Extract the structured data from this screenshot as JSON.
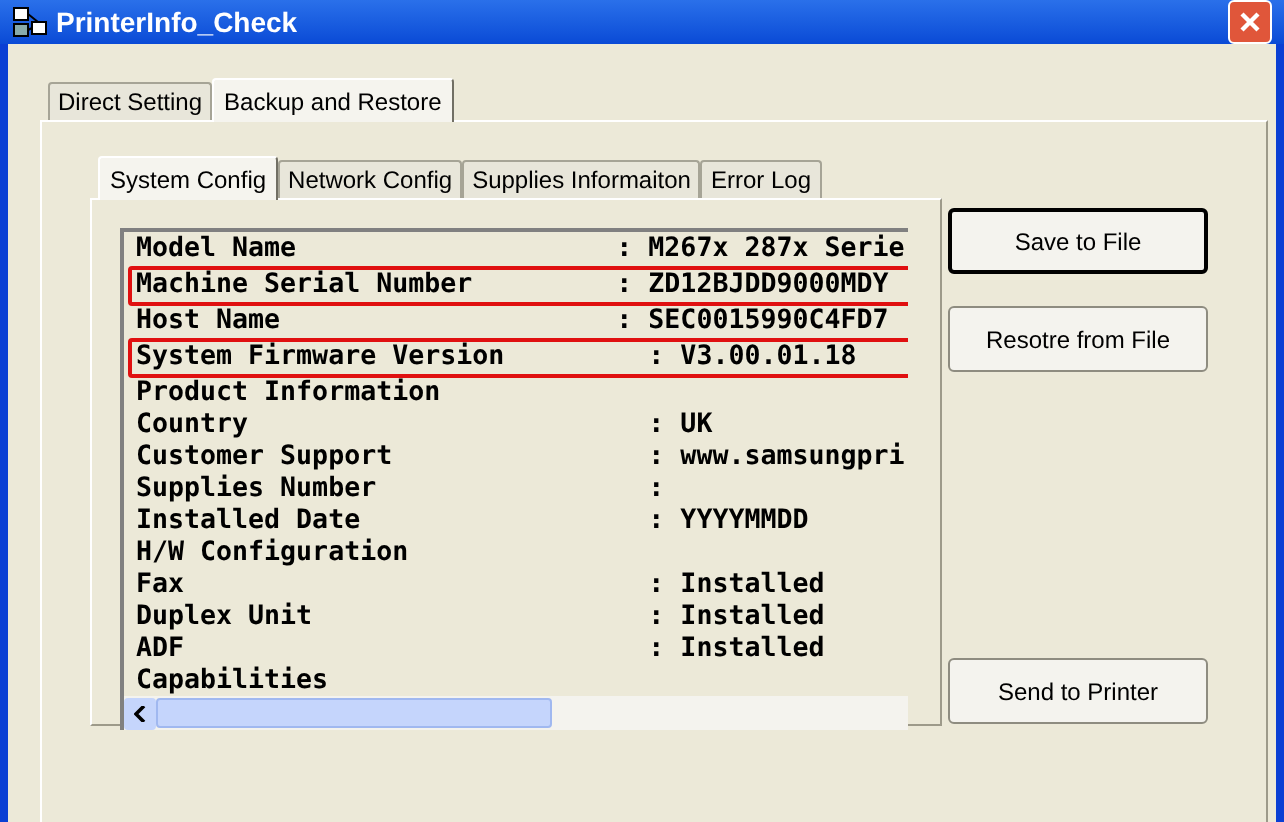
{
  "window": {
    "title": "PrinterInfo_Check"
  },
  "outer_tabs": [
    {
      "label": "Direct Setting",
      "selected": false
    },
    {
      "label": "Backup and Restore",
      "selected": true
    }
  ],
  "inner_tabs": [
    {
      "label": "System Config",
      "selected": true
    },
    {
      "label": "Network Config",
      "selected": false
    },
    {
      "label": "Supplies Informaiton",
      "selected": false
    },
    {
      "label": "Error Log",
      "selected": false
    }
  ],
  "lines": [
    {
      "text": "Model Name                    : M267x 287x Serie",
      "highlighted": false
    },
    {
      "text": "Machine Serial Number         : ZD12BJDD9000MDY",
      "highlighted": true
    },
    {
      "text": "Host Name                     : SEC0015990C4FD7",
      "highlighted": false
    },
    {
      "text": "System Firmware Version         : V3.00.01.18",
      "highlighted": true
    },
    {
      "text": "Product Information",
      "highlighted": false
    },
    {
      "text": "Country                         : UK",
      "highlighted": false
    },
    {
      "text": "Customer Support                : www.samsungpri",
      "highlighted": false
    },
    {
      "text": "Supplies Number                 :",
      "highlighted": false
    },
    {
      "text": "Installed Date                  : YYYYMMDD",
      "highlighted": false
    },
    {
      "text": "H/W Configuration",
      "highlighted": false
    },
    {
      "text": "Fax                             : Installed",
      "highlighted": false
    },
    {
      "text": "Duplex Unit                     : Installed",
      "highlighted": false
    },
    {
      "text": "ADF                             : Installed",
      "highlighted": false
    },
    {
      "text": "Capabilities",
      "highlighted": false
    }
  ],
  "buttons": [
    {
      "label": "Save to File",
      "default": true
    },
    {
      "label": "Resotre from File",
      "default": false
    },
    {
      "label": "Send to Printer",
      "default": false
    }
  ]
}
